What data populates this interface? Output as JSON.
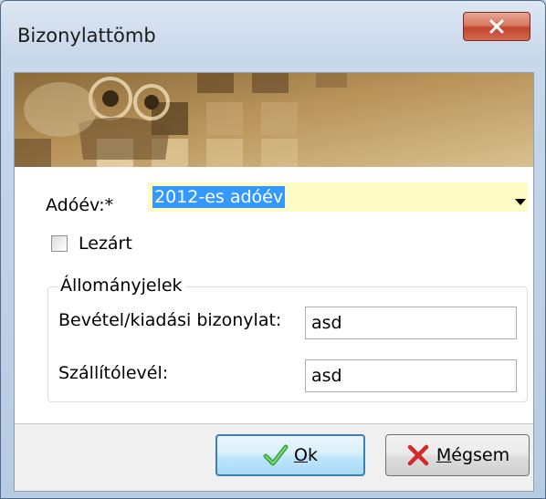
{
  "window": {
    "title": "Bizonylattömb"
  },
  "form": {
    "year_label": "Adóév:*",
    "year_value": "2012-es adóév",
    "closed_checkbox_label": "Lezárt",
    "closed_checked": false,
    "group_title": "Állományjelek",
    "fields": [
      {
        "label": "Bevétel/kiadási bizonylat:",
        "value": "asd"
      },
      {
        "label": "Szállítólevél:",
        "value": "asd"
      }
    ]
  },
  "buttons": {
    "ok_label_prefix": "O",
    "ok_label_rest": "k",
    "cancel_label_prefix": "M",
    "cancel_label_rest": "égsem"
  },
  "colors": {
    "selection": "#3399ff",
    "combo_background": "#fffcc6",
    "title_close_red": "#c0462f"
  },
  "icons": {
    "ok": "green-check-icon",
    "cancel": "red-x-icon",
    "close": "close-x-icon"
  }
}
